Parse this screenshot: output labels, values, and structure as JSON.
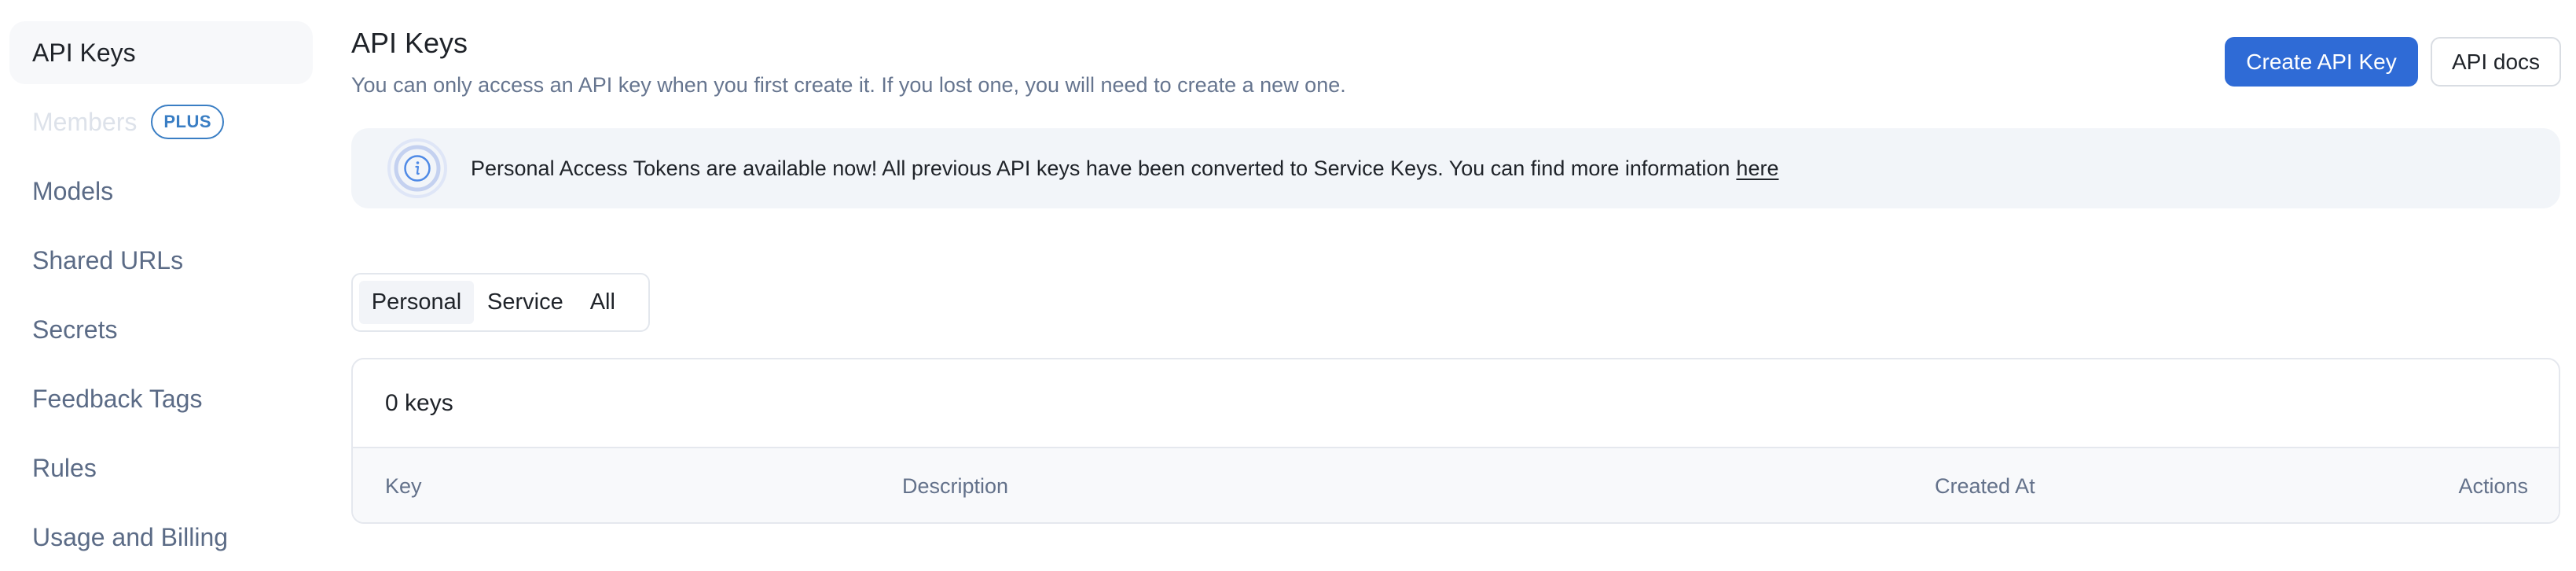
{
  "sidebar": {
    "items": [
      {
        "label": "API Keys",
        "state": "active"
      },
      {
        "label": "Members",
        "state": "disabled",
        "badge": "PLUS"
      },
      {
        "label": "Models"
      },
      {
        "label": "Shared URLs"
      },
      {
        "label": "Secrets"
      },
      {
        "label": "Feedback Tags"
      },
      {
        "label": "Rules"
      },
      {
        "label": "Usage and Billing"
      }
    ]
  },
  "header": {
    "title": "API Keys",
    "subtitle": "You can only access an API key when you first create it. If you lost one, you will need to create a new one.",
    "create_button": "Create API Key",
    "docs_button": "API docs"
  },
  "banner": {
    "icon": "info-icon",
    "text": "Personal Access Tokens are available now! All previous API keys have been converted to Service Keys. You can find more information",
    "link_text": "here"
  },
  "filter_tabs": {
    "selected": "Personal",
    "options": [
      "Personal",
      "Service",
      "All"
    ]
  },
  "table": {
    "count_label": "0 keys",
    "columns": [
      "Key",
      "Description",
      "Created At",
      "Actions"
    ],
    "rows": []
  },
  "colors": {
    "primary": "#2f6bd6",
    "badge": "#3a7ec4",
    "banner_bg": "#f2f5f9",
    "muted_text": "#66758f"
  }
}
